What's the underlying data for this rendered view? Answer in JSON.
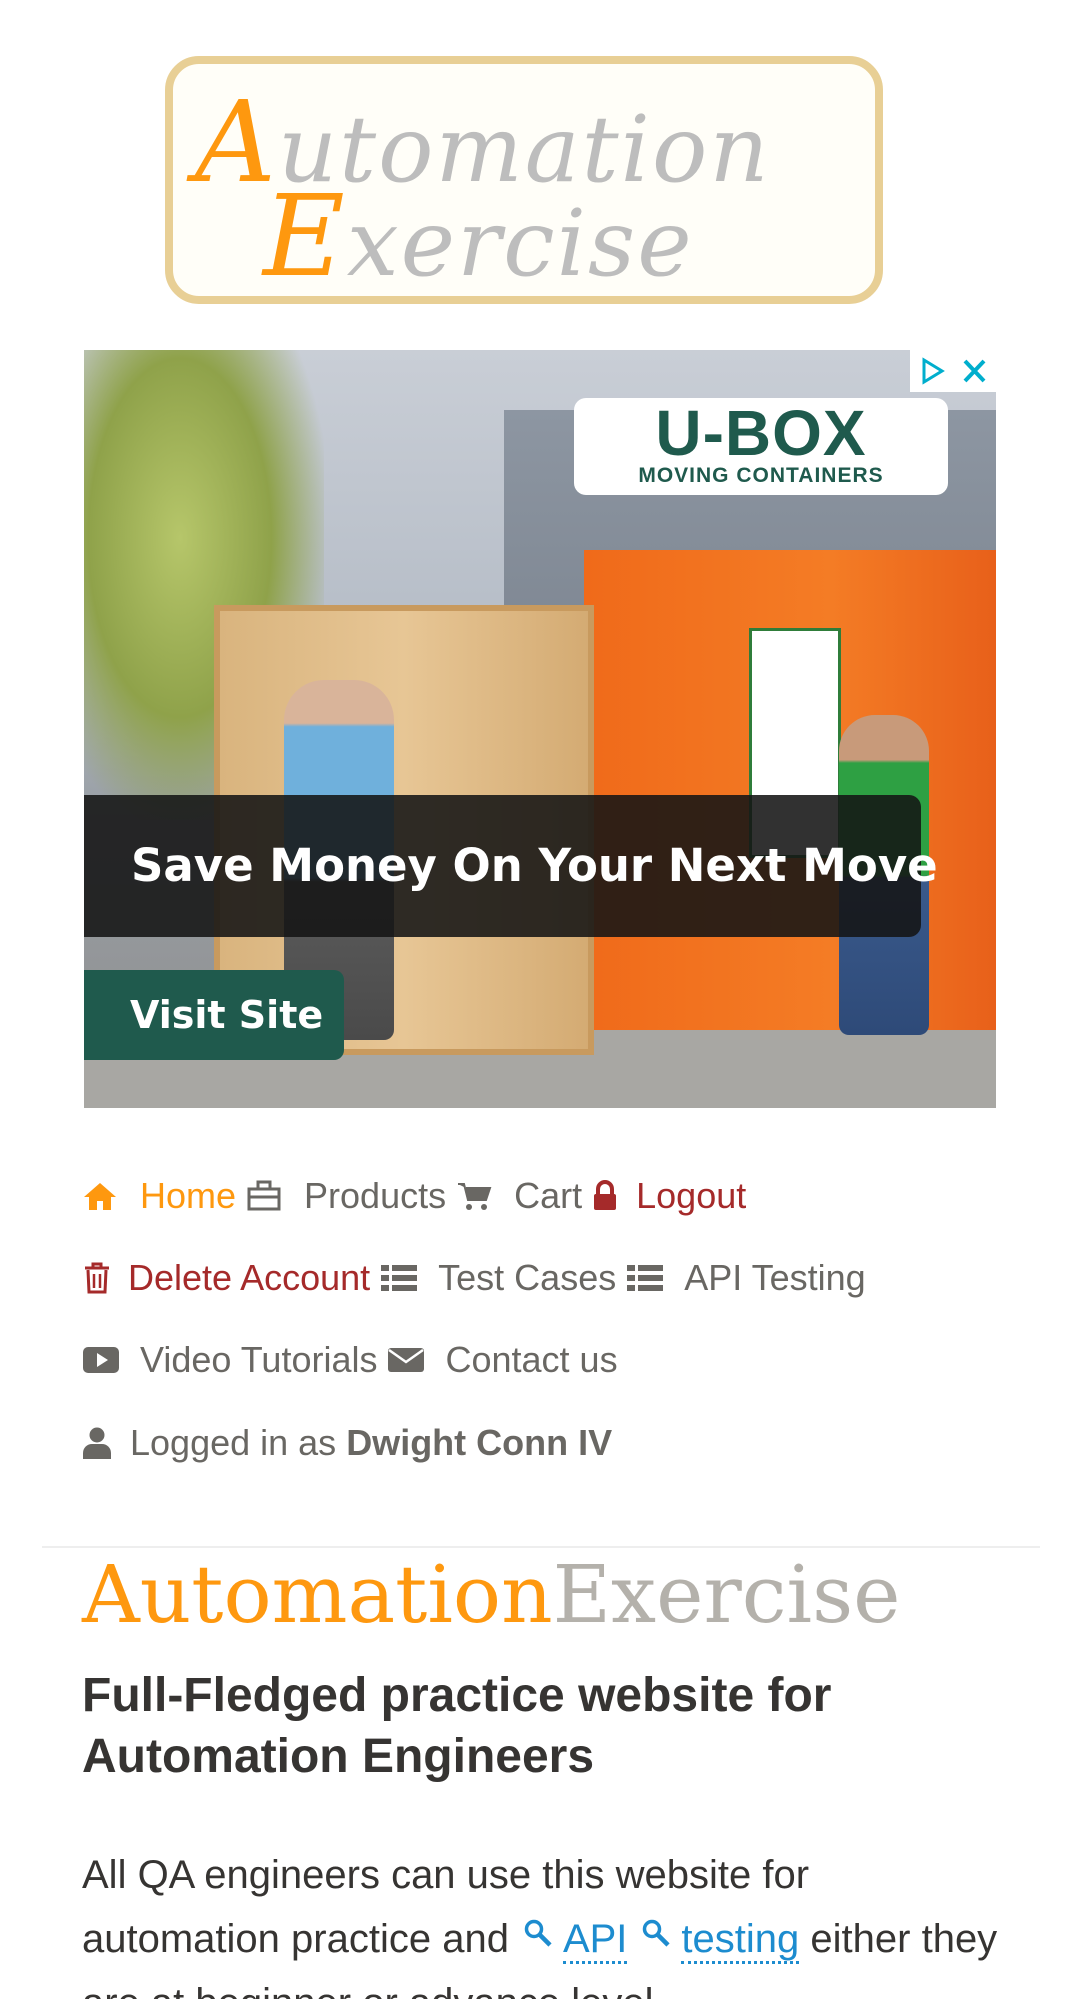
{
  "logo": {
    "line1_initial": "A",
    "line1_rest": "utomation",
    "line2_initial": "E",
    "line2_rest": "xercise"
  },
  "ad": {
    "brand_name": "U-BOX",
    "brand_subtitle": "MOVING CONTAINERS",
    "headline": "Save Money On Your Next Move",
    "cta": "Visit Site",
    "adchoices_icon": "play-triangle-icon",
    "close_icon": "close-icon",
    "colors": {
      "brand_green": "#1f5a4d",
      "container_orange": "#f47c25",
      "adchoices_blue": "#00aecd"
    }
  },
  "nav": {
    "home": {
      "label": "Home",
      "icon": "home-icon"
    },
    "products": {
      "label": "Products",
      "icon": "products-icon"
    },
    "cart": {
      "label": "Cart",
      "icon": "cart-icon"
    },
    "logout": {
      "label": "Logout",
      "icon": "lock-icon"
    },
    "delete_account": {
      "label": "Delete Account",
      "icon": "trash-icon"
    },
    "test_cases": {
      "label": "Test Cases",
      "icon": "list-icon"
    },
    "api_testing": {
      "label": "API Testing",
      "icon": "list-icon"
    },
    "video_tutorials": {
      "label": "Video Tutorials",
      "icon": "youtube-play-icon"
    },
    "contact_us": {
      "label": "Contact us",
      "icon": "envelope-icon"
    },
    "logged_in": {
      "prefix": "Logged in as",
      "username": "Dwight Conn IV",
      "icon": "user-icon"
    }
  },
  "hero": {
    "brand_orange": "Automation",
    "brand_grey": "Exercise",
    "subheading": "Full-Fledged practice website for Automation Engineers",
    "paragraph_part1": "All QA engineers can use this website for automation practice and",
    "link_api": "API",
    "link_testing": "testing",
    "paragraph_part2": "either they are at beginner or advance level."
  },
  "colors": {
    "accent": "#fe980f",
    "danger": "#a52a2a",
    "text": "#696763",
    "heading": "#363432",
    "link": "#1d8ccf",
    "grey_brand": "#b4b1ab"
  }
}
